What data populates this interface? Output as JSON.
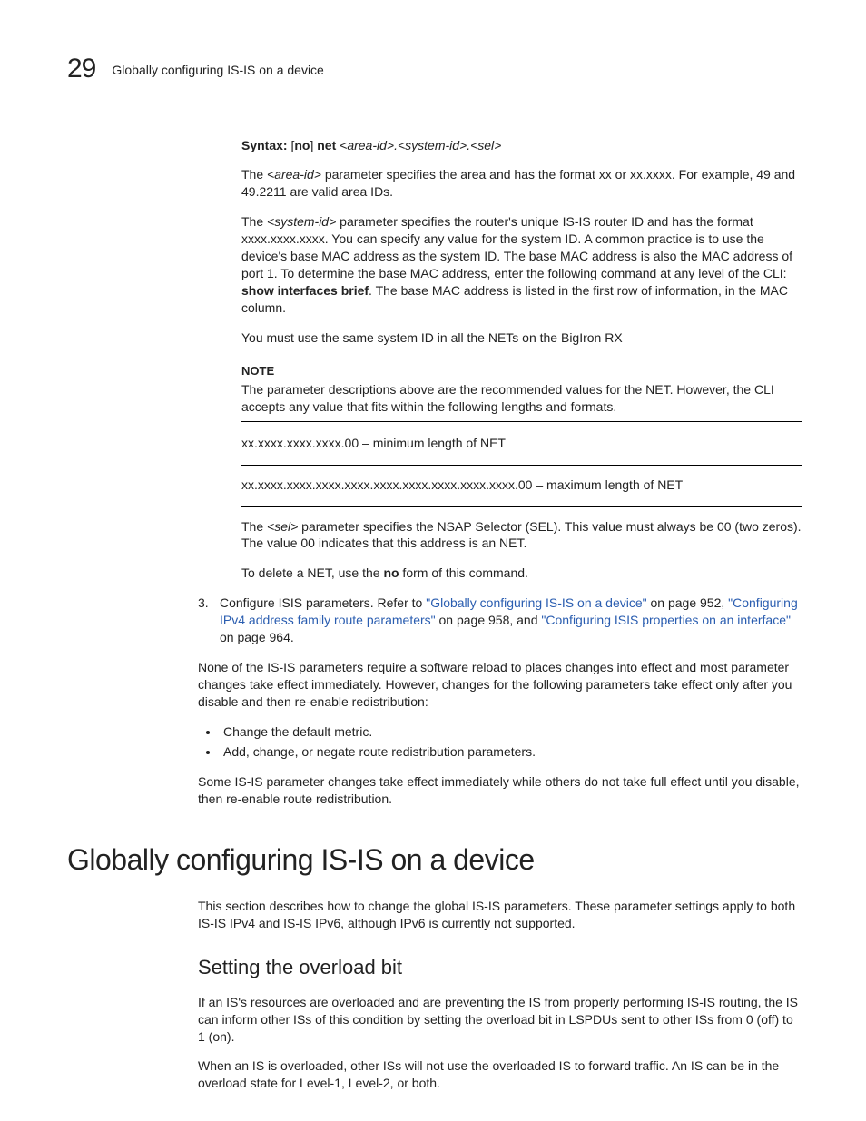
{
  "header": {
    "chapter": "29",
    "title": "Globally configuring IS-IS on a device"
  },
  "syntax": {
    "label": "Syntax:",
    "cmd_prefix": "[no] net ",
    "params": "<area-id>.<system-id>.<sel>"
  },
  "para_area": "The <area-id> parameter specifies the area and has the format xx or xx.xxxx. For example, 49 and 49.2211 are valid area IDs.",
  "para_sysid_a": "The <system-id> parameter specifies the router's unique IS-IS router ID and has the format xxxx.xxxx.xxxx. You can specify any value for the system ID. A common practice is to use the device's base MAC address as the system ID. The base MAC address is also the MAC address of port 1. To determine the base MAC address, enter the following command at any level of the CLI: ",
  "show_cmd": "show interfaces brief",
  "para_sysid_b": ". The base MAC address is listed in the first row of information, in the MAC column.",
  "para_same": "You must use the same system ID in all the NETs on the BigIron RX",
  "note": {
    "title": "NOTE",
    "body": "The parameter descriptions above are the recommended values for the NET. However, the CLI accepts any value that fits within the following lengths and formats.",
    "min": "xx.xxxx.xxxx.xxxx.00 – minimum length of NET",
    "max": "xx.xxxx.xxxx.xxxx.xxxx.xxxx.xxxx.xxxx.xxxx.xxxx.00 – maximum length of NET"
  },
  "para_sel": "The <sel> parameter specifies the NSAP Selector (SEL). This value must always be 00 (two zeros). The value 00 indicates that this address is an NET.",
  "para_delete_a": "To delete a NET, use the ",
  "para_delete_no": "no",
  "para_delete_b": " form of this command.",
  "step3": {
    "num": "3.",
    "lead": "Configure ISIS parameters. Refer to ",
    "link1": "\"Globally configuring IS-IS on a device\"",
    "after1": " on page 952, ",
    "link2": "\"Configuring IPv4 address family route parameters\"",
    "after2": " on page 958, and ",
    "link3": "\"Configuring ISIS properties on an interface\"",
    "after3": " on page 964."
  },
  "para_none": "None of the IS-IS parameters require a software reload to places changes into effect and most parameter changes take effect immediately. However, changes for the following parameters take effect only after you disable and then re-enable redistribution:",
  "bullets": [
    "Change the default metric.",
    "Add, change, or negate route redistribution parameters."
  ],
  "para_some": "Some IS-IS parameter changes take effect immediately while others do not take full effect until you disable, then re-enable route redistribution.",
  "h1": "Globally configuring IS-IS on a device",
  "para_intro": "This section describes how to change the global IS-IS parameters. These parameter settings apply to both IS-IS IPv4 and IS-IS IPv6, although IPv6 is currently not supported.",
  "h2": "Setting the overload bit",
  "para_ov1": "If an IS's resources are overloaded and are preventing the IS from properly performing IS-IS routing, the IS can inform other ISs of this condition by setting the overload bit in LSPDUs sent to other ISs from 0 (off) to 1 (on).",
  "para_ov2": "When an IS is overloaded, other ISs will not use the overloaded IS to forward traffic. An IS can be in the overload state for Level-1, Level-2, or both."
}
